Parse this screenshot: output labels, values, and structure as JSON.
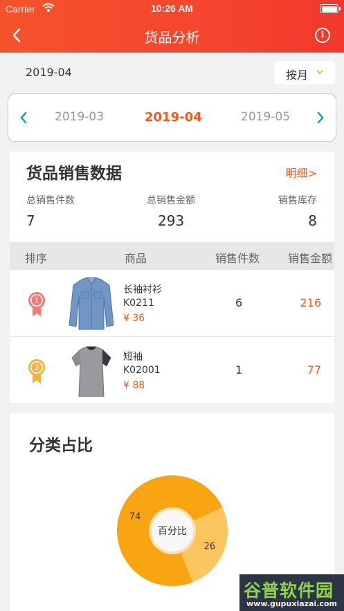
{
  "status_bar": {
    "carrier": "Carrier",
    "time": "10:26 AM"
  },
  "navbar": {
    "title": "货品分析",
    "back_icon": "chevron-left-icon",
    "info_icon": "info-circle-icon"
  },
  "period": {
    "current_label": "2019-04",
    "mode": "按月"
  },
  "month_picker": {
    "prev": "2019-03",
    "current": "2019-04",
    "next": "2019-05"
  },
  "sales": {
    "title": "货品销售数据",
    "detail_link": "明细>",
    "stats": [
      {
        "label": "总销售件数",
        "value": "7"
      },
      {
        "label": "总销售金额",
        "value": "293"
      },
      {
        "label": "销售库存",
        "value": "8"
      }
    ],
    "columns": [
      "排序",
      "商品",
      "销售件数",
      "销售金额"
    ],
    "rows": [
      {
        "rank": "1",
        "name": "长袖衬衫",
        "code": "K0211",
        "price": "¥ 36",
        "qty": "6",
        "amount": "216",
        "rank_color": "#f07a78",
        "product_image": "long-sleeve-shirt"
      },
      {
        "rank": "2",
        "name": "短袖",
        "code": "K02001",
        "price": "¥ 88",
        "qty": "1",
        "amount": "77",
        "rank_color": "#f6b33c",
        "product_image": "short-sleeve-tshirt"
      }
    ]
  },
  "category": {
    "title": "分类占比",
    "center_label": "百分比",
    "chart_data": {
      "type": "pie",
      "slices": [
        {
          "label": "74",
          "value": 74,
          "color": "#f9a411"
        },
        {
          "label": "26",
          "value": 26,
          "color": "#fcc65f"
        }
      ],
      "center_text": "百分比"
    }
  },
  "watermark": {
    "brand": "谷普软件园",
    "url": "www.gupuxiazai.com"
  },
  "colors": {
    "accent": "#f05a1e",
    "header": "#f5452e"
  }
}
